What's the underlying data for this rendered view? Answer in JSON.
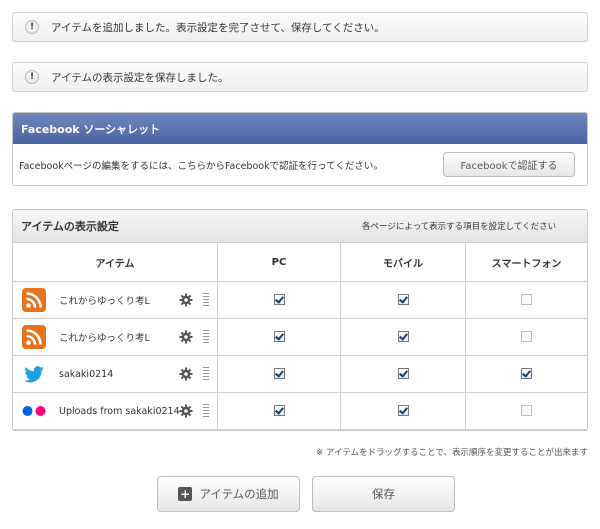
{
  "notices": [
    {
      "text": "アイテムを追加しました。表示設定を完了させて、保存してください。",
      "icon": "exclamation-icon"
    },
    {
      "text": "アイテムの表示設定を保存しました。",
      "icon": "exclamation-icon"
    }
  ],
  "facebook": {
    "title": "Facebook ソーシャレット",
    "description": "Facebookページの編集をするには、こちらからFacebookで認証を行ってください。",
    "auth_button": "Facebookで認証する"
  },
  "items_panel": {
    "title": "アイテムの表示設定",
    "hint": "各ページによって表示する項目を設定してください",
    "columns": [
      "アイテム",
      "PC",
      "モバイル",
      "スマートフォン"
    ],
    "rows": [
      {
        "icon": "rss-icon",
        "name": "これからゆっくり考L",
        "pc": true,
        "mobile": true,
        "smartphone": false
      },
      {
        "icon": "rss-icon",
        "name": "これからゆっくり考L",
        "pc": true,
        "mobile": true,
        "smartphone": false
      },
      {
        "icon": "twitter-icon",
        "name": "sakaki0214",
        "pc": true,
        "mobile": true,
        "smartphone": true
      },
      {
        "icon": "flickr-icon",
        "name": "Uploads from sakaki0214",
        "pc": true,
        "mobile": true,
        "smartphone": false
      }
    ]
  },
  "footnote": "※ アイテムをドラッグすることで、表示順序を変更することが出来ます",
  "buttons": {
    "add_item": "アイテムの追加",
    "save": "保存"
  },
  "colors": {
    "facebook_header": "#4a64a2",
    "rss": "#e8731c",
    "twitter": "#1da1e0",
    "flickr_blue": "#0063dc",
    "flickr_pink": "#ff0084"
  }
}
